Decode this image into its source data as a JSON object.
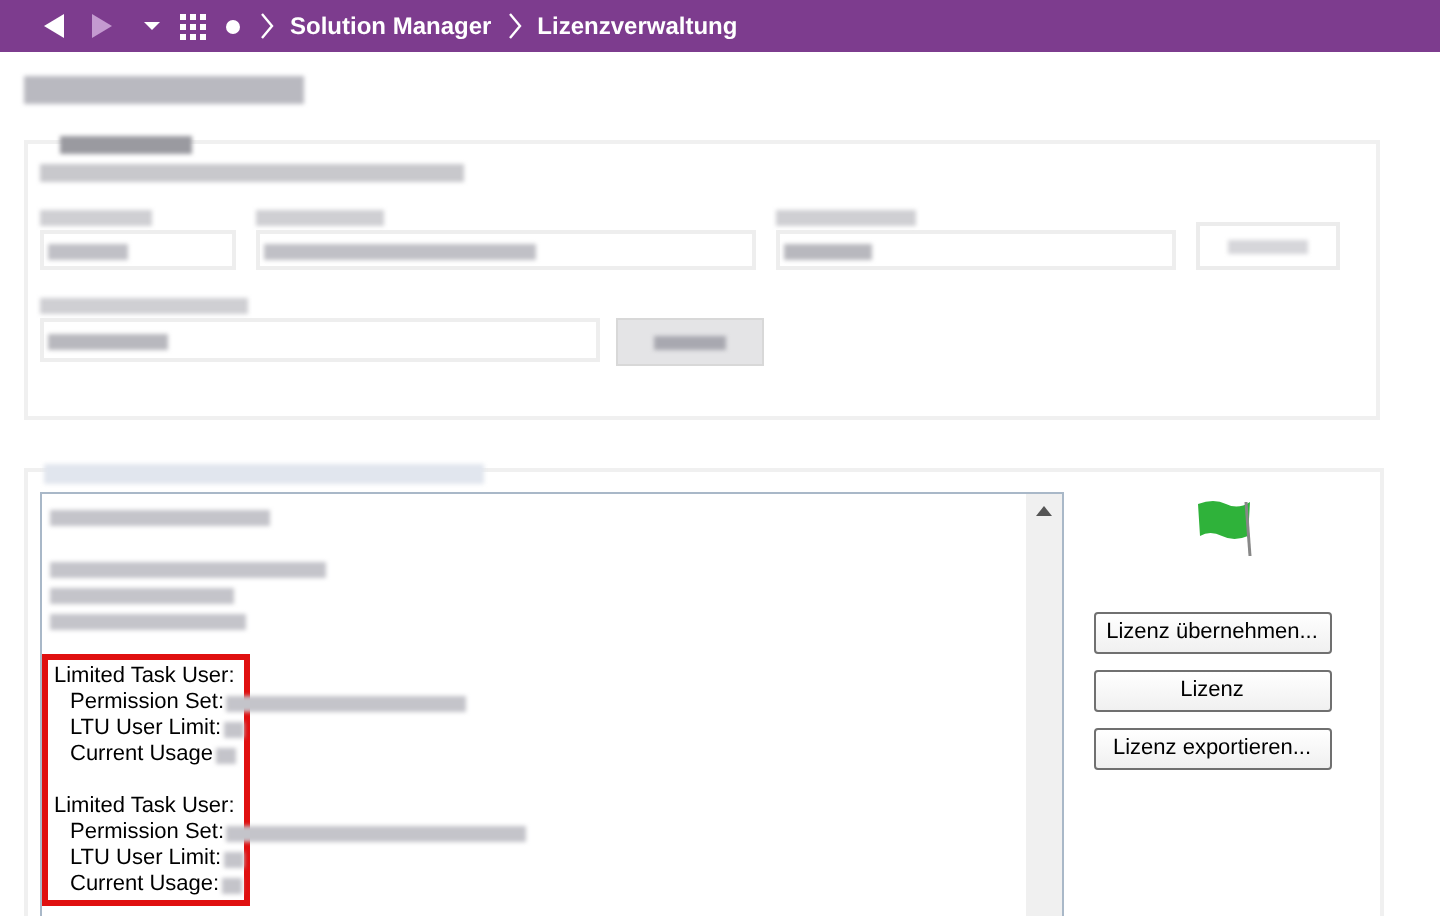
{
  "nav": {
    "breadcrumbs": [
      "Solution Manager",
      "Lizenzverwaltung"
    ]
  },
  "license": {
    "highlighted": true,
    "entries": [
      {
        "heading": "Limited Task User:",
        "fields": [
          "Permission Set:",
          "LTU User Limit:",
          "Current Usage"
        ]
      },
      {
        "heading": "Limited Task User:",
        "fields": [
          "Permission Set:",
          "LTU User Limit:",
          "Current Usage:"
        ]
      }
    ]
  },
  "buttons": [
    "Lizenz übernehmen...",
    "Lizenz",
    "Lizenz exportieren..."
  ]
}
